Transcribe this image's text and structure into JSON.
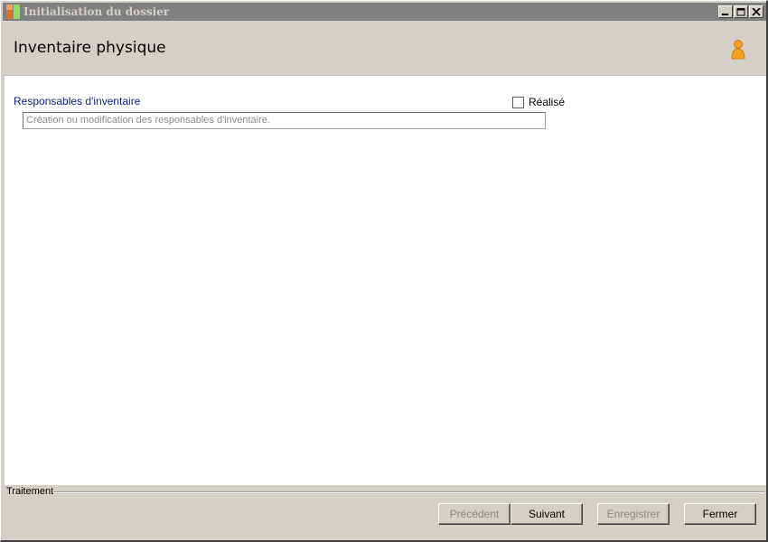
{
  "window": {
    "title": "Initialisation du dossier"
  },
  "header": {
    "title": "Inventaire physique",
    "icon": "user-icon"
  },
  "content": {
    "section_label": "Responsables d'inventaire",
    "description": "Création ou modification des responsables d'inventaire.",
    "checkbox": {
      "label": "Réalisé",
      "checked": false
    }
  },
  "footer": {
    "group_label": "Traitement",
    "buttons": {
      "previous": "Précédent",
      "next": "Suivant",
      "save": "Enregistrer",
      "close": "Fermer"
    }
  },
  "colors": {
    "titlebar": "#808080",
    "chrome": "#d4d0c8",
    "section_label": "#0a1f8f"
  }
}
